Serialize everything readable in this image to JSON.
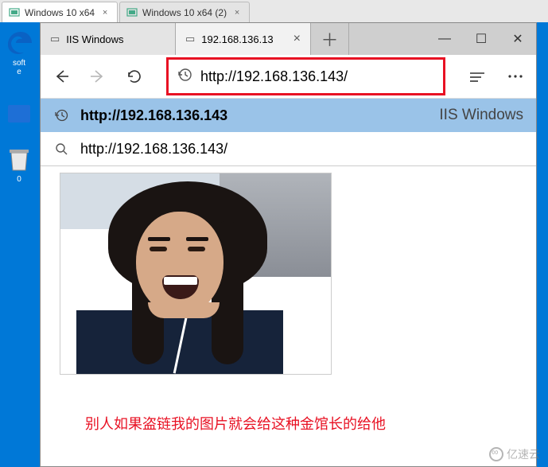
{
  "vm_tabs": [
    {
      "label": "Windows 10 x64",
      "active": true
    },
    {
      "label": "Windows 10 x64 (2)",
      "active": false
    }
  ],
  "desktop": {
    "edge_label_top": "soft",
    "edge_label_bottom": "e",
    "recycle_label_bottom": "0"
  },
  "browser": {
    "tabs": [
      {
        "label": "IIS Windows",
        "active": false
      },
      {
        "label": "192.168.136.13",
        "active": true
      }
    ],
    "new_tab_glyph": "＋",
    "window_controls": {
      "minimize": "—",
      "maximize": "☐",
      "close": "✕"
    },
    "toolbar": {
      "address_value": "http://192.168.136.143/",
      "history_icon": "↺"
    },
    "suggestions": [
      {
        "icon": "clock",
        "text": "http://192.168.136.143",
        "secondary": "IIS Windows",
        "highlighted": true
      },
      {
        "icon": "search",
        "text": "http://192.168.136.143/",
        "secondary": "",
        "highlighted": false
      }
    ]
  },
  "page": {
    "caption": "别人如果盗链我的图片就会给这种金馆长的给他"
  },
  "watermark": "亿速云"
}
